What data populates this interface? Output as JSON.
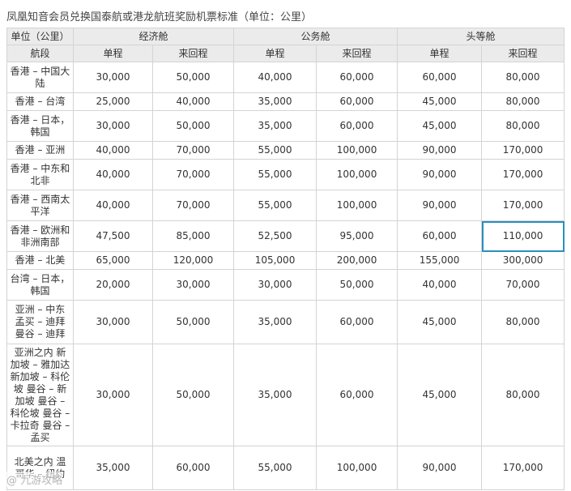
{
  "caption": "凤凰知音会员兑换国泰航或港龙航班奖励机票标准（单位：公里）",
  "header": {
    "unit": "单位（公里）",
    "segment": "航段",
    "economy": "经济舱",
    "business": "公务舱",
    "first": "头等舱",
    "oneway": "单程",
    "roundtrip": "来回程"
  },
  "rows": [
    {
      "route": "香港 – 中国大陆",
      "v": [
        "30,000",
        "50,000",
        "40,000",
        "60,000",
        "60,000",
        "80,000"
      ]
    },
    {
      "route": "香港 – 台湾",
      "v": [
        "25,000",
        "40,000",
        "35,000",
        "60,000",
        "45,000",
        "80,000"
      ]
    },
    {
      "route": "香港 – 日本，韩国",
      "v": [
        "30,000",
        "50,000",
        "35,000",
        "60,000",
        "45,000",
        "80,000"
      ]
    },
    {
      "route": "香港 – 亚洲",
      "v": [
        "40,000",
        "70,000",
        "55,000",
        "100,000",
        "90,000",
        "170,000"
      ]
    },
    {
      "route": "香港 – 中东和北非",
      "v": [
        "40,000",
        "70,000",
        "55,000",
        "100,000",
        "90,000",
        "170,000"
      ]
    },
    {
      "route": "香港 – 西南太平洋",
      "v": [
        "40,000",
        "70,000",
        "55,000",
        "100,000",
        "90,000",
        "170,000"
      ]
    },
    {
      "route": "香港 – 欧洲和非洲南部",
      "v": [
        "47,500",
        "85,000",
        "52,500",
        "95,000",
        "60,000",
        "110,000"
      ]
    },
    {
      "route": "香港 – 北美",
      "v": [
        "65,000",
        "120,000",
        "105,000",
        "200,000",
        "155,000",
        "300,000"
      ]
    },
    {
      "route": "台湾 – 日本，韩国",
      "v": [
        "20,000",
        "30,000",
        "30,000",
        "50,000",
        "40,000",
        "70,000"
      ]
    },
    {
      "route": "亚洲 – 中东 孟买 – 迪拜 曼谷 – 迪拜",
      "v": [
        "30,000",
        "50,000",
        "35,000",
        "60,000",
        "45,000",
        "80,000"
      ]
    },
    {
      "route": "亚洲之内 新加坡 – 雅加达 新加坡 – 科伦坡 曼谷 – 新加坡 曼谷 – 科伦坡 曼谷 – 卡拉奇 曼谷 – 孟买",
      "v": [
        "30,000",
        "50,000",
        "35,000",
        "60,000",
        "45,000",
        "80,000"
      ]
    },
    {
      "route": "北美之内 温哥华 – 纽约",
      "v": [
        "35,000",
        "60,000",
        "55,000",
        "100,000",
        "90,000",
        "170,000"
      ]
    }
  ],
  "watermark": "@ 九游攻略"
}
